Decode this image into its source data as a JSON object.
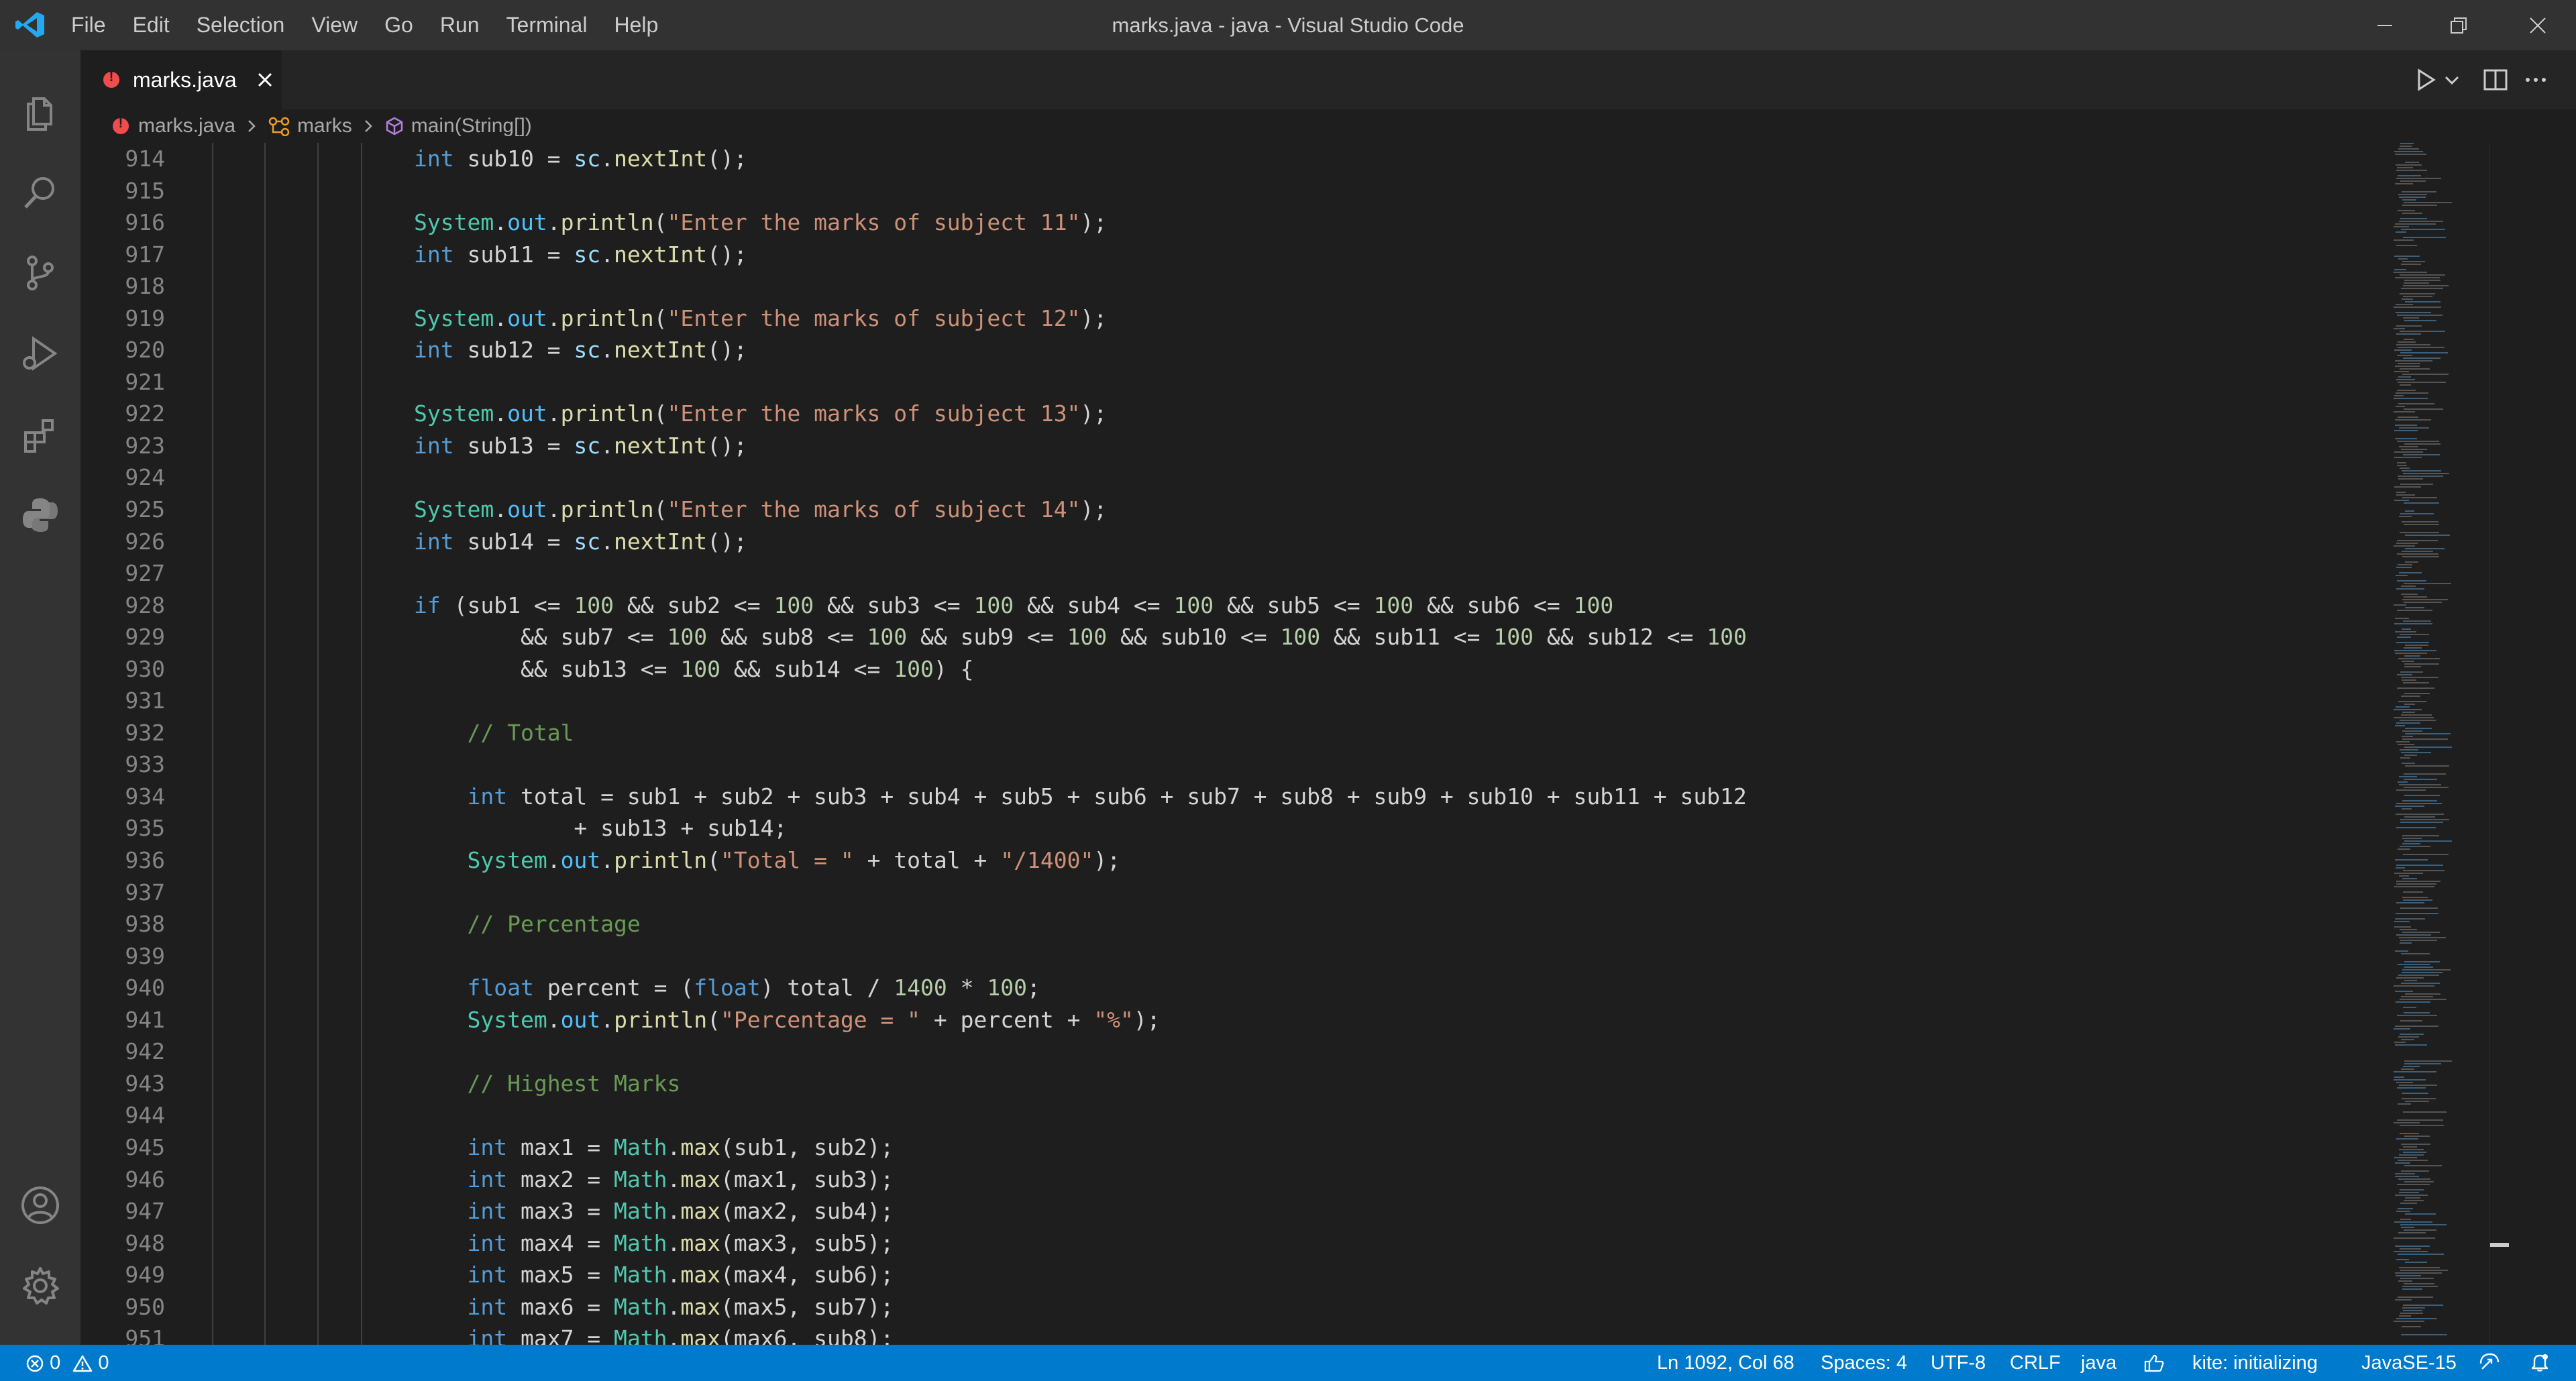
{
  "window": {
    "title": "marks.java - java - Visual Studio Code"
  },
  "menu": [
    "File",
    "Edit",
    "Selection",
    "View",
    "Go",
    "Run",
    "Terminal",
    "Help"
  ],
  "tab": {
    "label": "marks.java"
  },
  "breadcrumb": {
    "file": "marks.java",
    "class": "marks",
    "method": "main(String[])"
  },
  "code": {
    "lines": [
      {
        "n": "914",
        "tokens": [
          [
            "kw",
            "int"
          ],
          [
            "p",
            " sub10 = "
          ],
          [
            "var",
            "sc"
          ],
          [
            "p",
            "."
          ],
          [
            "fn",
            "nextInt"
          ],
          [
            "p",
            "();"
          ]
        ]
      },
      {
        "n": "915",
        "tokens": []
      },
      {
        "n": "916",
        "tokens": [
          [
            "cls",
            "System"
          ],
          [
            "p",
            "."
          ],
          [
            "fld",
            "out"
          ],
          [
            "p",
            "."
          ],
          [
            "fn",
            "println"
          ],
          [
            "p",
            "("
          ],
          [
            "str",
            "\"Enter the marks of subject 11\""
          ],
          [
            "p",
            ");"
          ]
        ]
      },
      {
        "n": "917",
        "tokens": [
          [
            "kw",
            "int"
          ],
          [
            "p",
            " sub11 = "
          ],
          [
            "var",
            "sc"
          ],
          [
            "p",
            "."
          ],
          [
            "fn",
            "nextInt"
          ],
          [
            "p",
            "();"
          ]
        ]
      },
      {
        "n": "918",
        "tokens": []
      },
      {
        "n": "919",
        "tokens": [
          [
            "cls",
            "System"
          ],
          [
            "p",
            "."
          ],
          [
            "fld",
            "out"
          ],
          [
            "p",
            "."
          ],
          [
            "fn",
            "println"
          ],
          [
            "p",
            "("
          ],
          [
            "str",
            "\"Enter the marks of subject 12\""
          ],
          [
            "p",
            ");"
          ]
        ]
      },
      {
        "n": "920",
        "tokens": [
          [
            "kw",
            "int"
          ],
          [
            "p",
            " sub12 = "
          ],
          [
            "var",
            "sc"
          ],
          [
            "p",
            "."
          ],
          [
            "fn",
            "nextInt"
          ],
          [
            "p",
            "();"
          ]
        ]
      },
      {
        "n": "921",
        "tokens": []
      },
      {
        "n": "922",
        "tokens": [
          [
            "cls",
            "System"
          ],
          [
            "p",
            "."
          ],
          [
            "fld",
            "out"
          ],
          [
            "p",
            "."
          ],
          [
            "fn",
            "println"
          ],
          [
            "p",
            "("
          ],
          [
            "str",
            "\"Enter the marks of subject 13\""
          ],
          [
            "p",
            ");"
          ]
        ]
      },
      {
        "n": "923",
        "tokens": [
          [
            "kw",
            "int"
          ],
          [
            "p",
            " sub13 = "
          ],
          [
            "var",
            "sc"
          ],
          [
            "p",
            "."
          ],
          [
            "fn",
            "nextInt"
          ],
          [
            "p",
            "();"
          ]
        ]
      },
      {
        "n": "924",
        "tokens": []
      },
      {
        "n": "925",
        "tokens": [
          [
            "cls",
            "System"
          ],
          [
            "p",
            "."
          ],
          [
            "fld",
            "out"
          ],
          [
            "p",
            "."
          ],
          [
            "fn",
            "println"
          ],
          [
            "p",
            "("
          ],
          [
            "str",
            "\"Enter the marks of subject 14\""
          ],
          [
            "p",
            ");"
          ]
        ]
      },
      {
        "n": "926",
        "tokens": [
          [
            "kw",
            "int"
          ],
          [
            "p",
            " sub14 = "
          ],
          [
            "var",
            "sc"
          ],
          [
            "p",
            "."
          ],
          [
            "fn",
            "nextInt"
          ],
          [
            "p",
            "();"
          ]
        ]
      },
      {
        "n": "927",
        "tokens": []
      },
      {
        "n": "928",
        "tokens": [
          [
            "kw",
            "if"
          ],
          [
            "p",
            " (sub1 <= "
          ],
          [
            "num",
            "100"
          ],
          [
            "p",
            " && sub2 <= "
          ],
          [
            "num",
            "100"
          ],
          [
            "p",
            " && sub3 <= "
          ],
          [
            "num",
            "100"
          ],
          [
            "p",
            " && sub4 <= "
          ],
          [
            "num",
            "100"
          ],
          [
            "p",
            " && sub5 <= "
          ],
          [
            "num",
            "100"
          ],
          [
            "p",
            " && sub6 <= "
          ],
          [
            "num",
            "100"
          ]
        ]
      },
      {
        "n": "929",
        "tokens": [
          [
            "p",
            "        && sub7 <= "
          ],
          [
            "num",
            "100"
          ],
          [
            "p",
            " && sub8 <= "
          ],
          [
            "num",
            "100"
          ],
          [
            "p",
            " && sub9 <= "
          ],
          [
            "num",
            "100"
          ],
          [
            "p",
            " && sub10 <= "
          ],
          [
            "num",
            "100"
          ],
          [
            "p",
            " && sub11 <= "
          ],
          [
            "num",
            "100"
          ],
          [
            "p",
            " && sub12 <= "
          ],
          [
            "num",
            "100"
          ]
        ]
      },
      {
        "n": "930",
        "tokens": [
          [
            "p",
            "        && sub13 <= "
          ],
          [
            "num",
            "100"
          ],
          [
            "p",
            " && sub14 <= "
          ],
          [
            "num",
            "100"
          ],
          [
            "p",
            ") {"
          ]
        ]
      },
      {
        "n": "931",
        "tokens": []
      },
      {
        "n": "932",
        "tokens": [
          [
            "p",
            "    "
          ],
          [
            "cm",
            "// Total"
          ]
        ]
      },
      {
        "n": "933",
        "tokens": []
      },
      {
        "n": "934",
        "tokens": [
          [
            "p",
            "    "
          ],
          [
            "kw",
            "int"
          ],
          [
            "p",
            " total = sub1 + sub2 + sub3 + sub4 + sub5 + sub6 + sub7 + sub8 + sub9 + sub10 + sub11 + sub12"
          ]
        ]
      },
      {
        "n": "935",
        "tokens": [
          [
            "p",
            "            + sub13 + sub14;"
          ]
        ]
      },
      {
        "n": "936",
        "tokens": [
          [
            "p",
            "    "
          ],
          [
            "cls",
            "System"
          ],
          [
            "p",
            "."
          ],
          [
            "fld",
            "out"
          ],
          [
            "p",
            "."
          ],
          [
            "fn",
            "println"
          ],
          [
            "p",
            "("
          ],
          [
            "str",
            "\"Total = \""
          ],
          [
            "p",
            " + total + "
          ],
          [
            "str",
            "\"/1400\""
          ],
          [
            "p",
            ");"
          ]
        ]
      },
      {
        "n": "937",
        "tokens": []
      },
      {
        "n": "938",
        "tokens": [
          [
            "p",
            "    "
          ],
          [
            "cm",
            "// Percentage"
          ]
        ]
      },
      {
        "n": "939",
        "tokens": []
      },
      {
        "n": "940",
        "tokens": [
          [
            "p",
            "    "
          ],
          [
            "kw",
            "float"
          ],
          [
            "p",
            " percent = ("
          ],
          [
            "kw",
            "float"
          ],
          [
            "p",
            ") total / "
          ],
          [
            "num",
            "1400"
          ],
          [
            "p",
            " * "
          ],
          [
            "num",
            "100"
          ],
          [
            "p",
            ";"
          ]
        ]
      },
      {
        "n": "941",
        "tokens": [
          [
            "p",
            "    "
          ],
          [
            "cls",
            "System"
          ],
          [
            "p",
            "."
          ],
          [
            "fld",
            "out"
          ],
          [
            "p",
            "."
          ],
          [
            "fn",
            "println"
          ],
          [
            "p",
            "("
          ],
          [
            "str",
            "\"Percentage = \""
          ],
          [
            "p",
            " + percent + "
          ],
          [
            "str",
            "\"%\""
          ],
          [
            "p",
            ");"
          ]
        ]
      },
      {
        "n": "942",
        "tokens": []
      },
      {
        "n": "943",
        "tokens": [
          [
            "p",
            "    "
          ],
          [
            "cm",
            "// Highest Marks"
          ]
        ]
      },
      {
        "n": "944",
        "tokens": []
      },
      {
        "n": "945",
        "tokens": [
          [
            "p",
            "    "
          ],
          [
            "kw",
            "int"
          ],
          [
            "p",
            " max1 = "
          ],
          [
            "cls",
            "Math"
          ],
          [
            "p",
            "."
          ],
          [
            "fn",
            "max"
          ],
          [
            "p",
            "(sub1, sub2);"
          ]
        ]
      },
      {
        "n": "946",
        "tokens": [
          [
            "p",
            "    "
          ],
          [
            "kw",
            "int"
          ],
          [
            "p",
            " max2 = "
          ],
          [
            "cls",
            "Math"
          ],
          [
            "p",
            "."
          ],
          [
            "fn",
            "max"
          ],
          [
            "p",
            "(max1, sub3);"
          ]
        ]
      },
      {
        "n": "947",
        "tokens": [
          [
            "p",
            "    "
          ],
          [
            "kw",
            "int"
          ],
          [
            "p",
            " max3 = "
          ],
          [
            "cls",
            "Math"
          ],
          [
            "p",
            "."
          ],
          [
            "fn",
            "max"
          ],
          [
            "p",
            "(max2, sub4);"
          ]
        ]
      },
      {
        "n": "948",
        "tokens": [
          [
            "p",
            "    "
          ],
          [
            "kw",
            "int"
          ],
          [
            "p",
            " max4 = "
          ],
          [
            "cls",
            "Math"
          ],
          [
            "p",
            "."
          ],
          [
            "fn",
            "max"
          ],
          [
            "p",
            "(max3, sub5);"
          ]
        ]
      },
      {
        "n": "949",
        "tokens": [
          [
            "p",
            "    "
          ],
          [
            "kw",
            "int"
          ],
          [
            "p",
            " max5 = "
          ],
          [
            "cls",
            "Math"
          ],
          [
            "p",
            "."
          ],
          [
            "fn",
            "max"
          ],
          [
            "p",
            "(max4, sub6);"
          ]
        ]
      },
      {
        "n": "950",
        "tokens": [
          [
            "p",
            "    "
          ],
          [
            "kw",
            "int"
          ],
          [
            "p",
            " max6 = "
          ],
          [
            "cls",
            "Math"
          ],
          [
            "p",
            "."
          ],
          [
            "fn",
            "max"
          ],
          [
            "p",
            "(max5, sub7);"
          ]
        ]
      },
      {
        "n": "951",
        "tokens": [
          [
            "p",
            "    "
          ],
          [
            "kw",
            "int"
          ],
          [
            "p",
            " max7 = "
          ],
          [
            "cls",
            "Math"
          ],
          [
            "p",
            "."
          ],
          [
            "fn",
            "max"
          ],
          [
            "p",
            "(max6, sub8);"
          ]
        ]
      }
    ]
  },
  "status": {
    "errors": "0",
    "warnings": "0",
    "position": "Ln 1092, Col 68",
    "spaces": "Spaces: 4",
    "encoding": "UTF-8",
    "eol": "CRLF",
    "language": "java",
    "kite": "kite: initializing",
    "jdk": "JavaSE-15"
  },
  "colors": {
    "accent": "#007acc",
    "error": "#f14c4c"
  }
}
